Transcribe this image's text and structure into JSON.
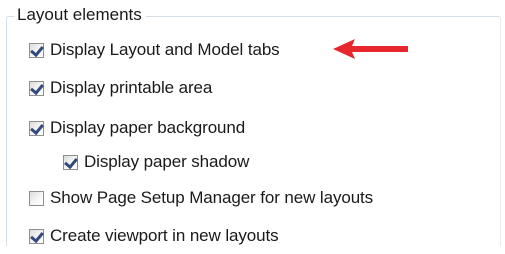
{
  "group": {
    "title": "Layout elements"
  },
  "options": [
    {
      "label": "Display Layout and Model tabs",
      "checked": true
    },
    {
      "label": "Display printable area",
      "checked": true
    },
    {
      "label": "Display paper background",
      "checked": true
    },
    {
      "label": "Display paper shadow",
      "checked": true
    },
    {
      "label": "Show Page Setup Manager for new layouts",
      "checked": false
    },
    {
      "label": "Create viewport in new layouts",
      "checked": true
    }
  ],
  "annotation": {
    "arrow_icon": "left-arrow-icon",
    "arrow_color": "#e8262e"
  }
}
